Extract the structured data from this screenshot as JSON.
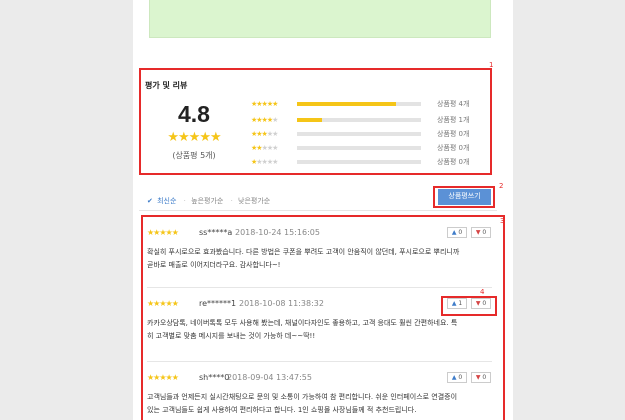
{
  "annotations": {
    "n1": "1",
    "n2": "2",
    "n3": "3",
    "n4": "4"
  },
  "rating": {
    "title": "평가 및 리뷰",
    "average": "4.8",
    "stars": "★★★★★",
    "count_label": "(상품평 5개)",
    "distribution": [
      {
        "stars": 5,
        "fraction": 0.8,
        "label": "상품평 4개"
      },
      {
        "stars": 4,
        "fraction": 0.2,
        "label": "상품평 1개"
      },
      {
        "stars": 3,
        "fraction": 0.0,
        "label": "상품평 0개"
      },
      {
        "stars": 2,
        "fraction": 0.0,
        "label": "상품평 0개"
      },
      {
        "stars": 1,
        "fraction": 0.0,
        "label": "상품평 0개"
      }
    ]
  },
  "sort": {
    "check": "✔",
    "latest": "최신순",
    "high": "높은평가순",
    "low": "낮은평가순"
  },
  "write_button": "상품평쓰기",
  "reviews": [
    {
      "stars": "★★★★★",
      "user": "ss*****a",
      "date": "2018-10-24 15:16:05",
      "body": [
        "확실히 푸시로으로 효과봤습니다. 다른 방법은 쿠폰을 뿌려도 고객이 안움직이 않던데, 푸시로으로 뿌리니까",
        "곧바로 매출로 이어지더라구요. 감사합니다~!"
      ],
      "likes": "0",
      "dislikes": "0"
    },
    {
      "stars": "★★★★★",
      "user": "re******1",
      "date": "2018-10-08 11:38:32",
      "body": [
        "카카오상담톡, 네이버톡톡 모두 사용해 봤는데, 채널이다자인도 좋용하고, 고객 응대도 훨씬 간편하네요. 특",
        "히 고객별로 맞춤 메시지를 보내는 것이 가능하 데~~딱!!"
      ],
      "likes": "1",
      "dislikes": "0"
    },
    {
      "stars": "★★★★★",
      "user": "sh****0",
      "date": "2018-09-04 13:47:55",
      "body": [
        "고객님들과 언제든지 실시간채팅으로 문의 및 소통이 가능하여 참 편리합니다. 쉬운 인터페이스로 연결증이",
        "있는 고객님들도 쉽게 사용하여 편리하다고 합니다. 1인 쇼핑몰 사장님들께 적 추천드립니다."
      ],
      "likes": "0",
      "dislikes": "0"
    }
  ],
  "icons": {
    "like": "thumbs-up-icon",
    "dislike": "thumbs-down-icon"
  },
  "colors": {
    "star": "#f5c518",
    "accent": "#5b91d6",
    "highlight": "#e62a2a"
  }
}
